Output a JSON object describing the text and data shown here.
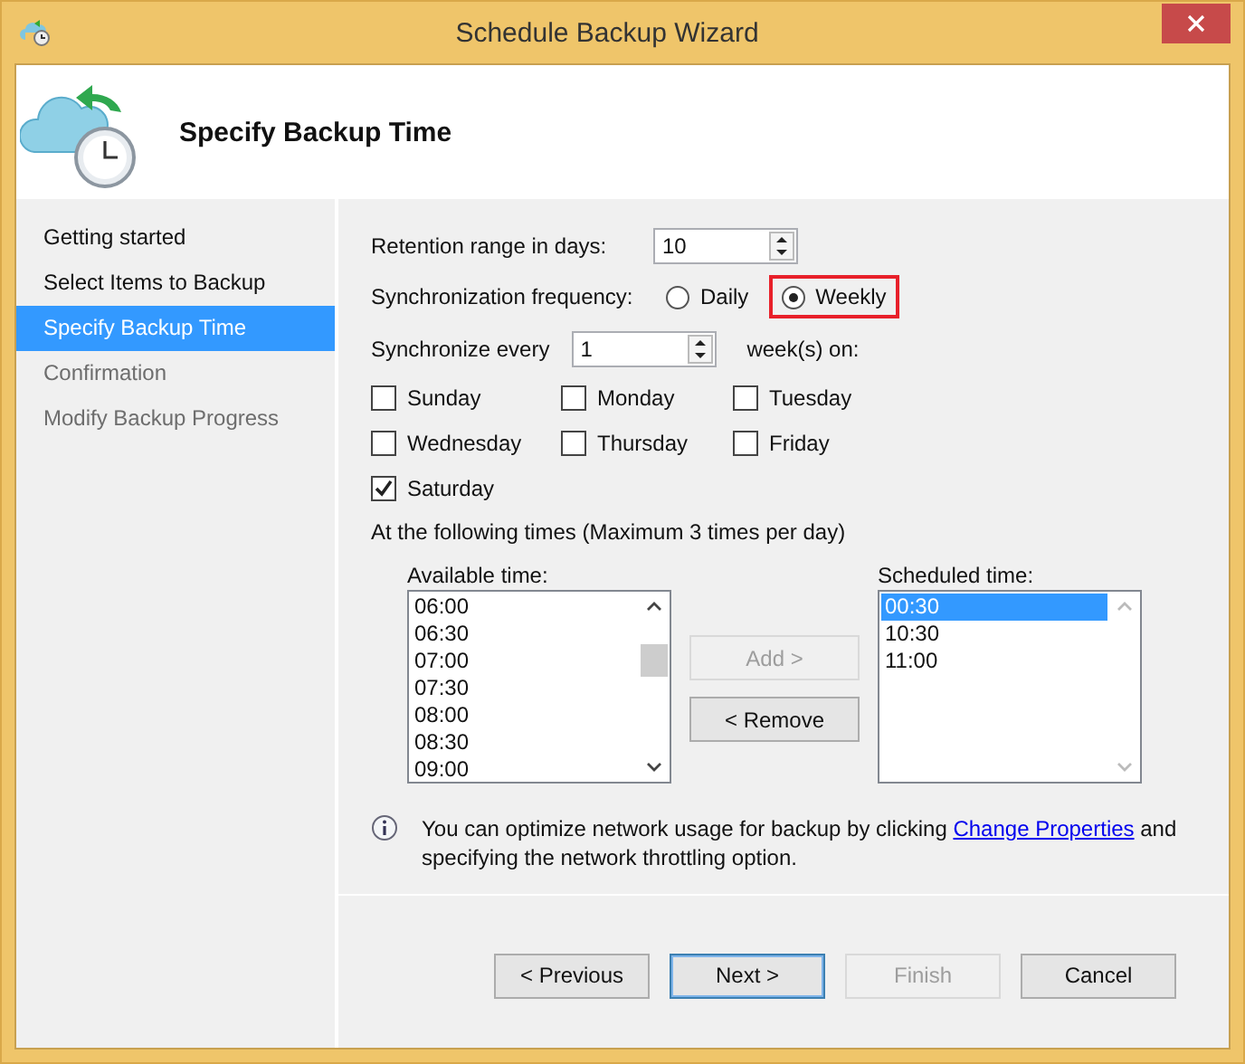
{
  "window": {
    "title": "Schedule Backup Wizard"
  },
  "header": {
    "title": "Specify Backup Time"
  },
  "sidebar": {
    "items": [
      {
        "label": "Getting started",
        "selected": false,
        "disabled": false
      },
      {
        "label": "Select Items to Backup",
        "selected": false,
        "disabled": false
      },
      {
        "label": "Specify Backup Time",
        "selected": true,
        "disabled": false
      },
      {
        "label": "Confirmation",
        "selected": false,
        "disabled": true
      },
      {
        "label": "Modify Backup Progress",
        "selected": false,
        "disabled": true
      }
    ]
  },
  "retention": {
    "label": "Retention range in days:",
    "value": "10"
  },
  "frequency": {
    "label": "Synchronization frequency:",
    "options": [
      {
        "label": "Daily",
        "selected": false,
        "highlighted": false
      },
      {
        "label": "Weekly",
        "selected": true,
        "highlighted": true
      }
    ]
  },
  "sync_every": {
    "label": "Synchronize every",
    "value": "1",
    "suffix": "week(s) on:"
  },
  "days": [
    {
      "label": "Sunday",
      "checked": false
    },
    {
      "label": "Monday",
      "checked": false
    },
    {
      "label": "Tuesday",
      "checked": false
    },
    {
      "label": "Wednesday",
      "checked": false
    },
    {
      "label": "Thursday",
      "checked": false
    },
    {
      "label": "Friday",
      "checked": false
    },
    {
      "label": "Saturday",
      "checked": true
    }
  ],
  "times_label": "At the following times (Maximum 3 times per day)",
  "available": {
    "label": "Available time:",
    "items": [
      {
        "label": "06:00",
        "selected": false
      },
      {
        "label": "06:30",
        "selected": false
      },
      {
        "label": "07:00",
        "selected": false
      },
      {
        "label": "07:30",
        "selected": false
      },
      {
        "label": "08:00",
        "selected": false
      },
      {
        "label": "08:30",
        "selected": false
      },
      {
        "label": "09:00",
        "selected": false
      }
    ]
  },
  "move_buttons": [
    {
      "label": "Add >",
      "disabled": true
    },
    {
      "label": "< Remove",
      "disabled": false
    }
  ],
  "scheduled": {
    "label": "Scheduled time:",
    "items": [
      {
        "label": "00:30",
        "selected": true
      },
      {
        "label": "10:30",
        "selected": false
      },
      {
        "label": "11:00",
        "selected": false
      }
    ]
  },
  "info": {
    "text_before": "You can optimize network usage for backup by clicking",
    "link": "Change Properties",
    "text_after": "and specifying the network throttling option."
  },
  "buttons": [
    {
      "label": "< Previous",
      "disabled": false,
      "default": false
    },
    {
      "label": "Next >",
      "disabled": false,
      "default": true
    },
    {
      "label": "Finish",
      "disabled": true,
      "default": false
    },
    {
      "label": "Cancel",
      "disabled": false,
      "default": false
    }
  ]
}
